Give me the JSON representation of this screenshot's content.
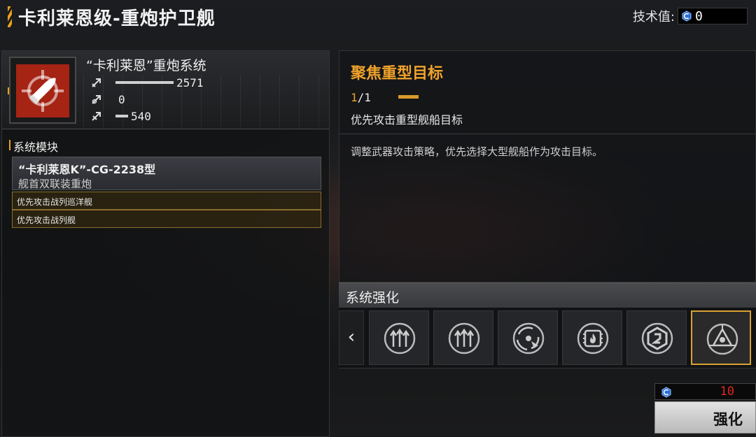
{
  "header": {
    "title": "卡利莱恩级-重炮护卫舰",
    "tech_label": "技术值:",
    "tech_value": "0"
  },
  "weapon": {
    "name": "“卡利莱恩”重炮系统",
    "stats": [
      {
        "icon": "damage-icon",
        "value": "2571",
        "bar": 0.54
      },
      {
        "icon": "range-icon",
        "value": "0",
        "bar": 0
      },
      {
        "icon": "armor-pierce-icon",
        "value": "540",
        "bar": 0.12
      }
    ]
  },
  "modules": {
    "title": "系统模块",
    "module_name": "“卡利莱恩K”-CG-2238型",
    "module_sub": "舰首双联装重炮",
    "options": [
      "优先攻击战列巡洋舰",
      "优先攻击战列舰"
    ]
  },
  "focus": {
    "title": "聚焦重型目标",
    "level_current": "1",
    "level_total": "/1",
    "level_fill": 1.0,
    "desc": "优先攻击重型舰船目标",
    "long_desc": "调整武器攻击策略，优先选择大型舰船作为攻击目标。"
  },
  "enhance": {
    "title": "系统强化",
    "prev_arrow": "‹",
    "slots": [
      {
        "icon": "triple-arrow-up-icon",
        "selected": false
      },
      {
        "icon": "triple-arrow-up-icon",
        "selected": false
      },
      {
        "icon": "radar-sweep-icon",
        "selected": false
      },
      {
        "icon": "fire-chip-icon",
        "selected": false
      },
      {
        "icon": "hex-shield-icon",
        "selected": false
      },
      {
        "icon": "target-focus-icon",
        "selected": true
      }
    ],
    "cost": "10",
    "button": "强化"
  },
  "colors": {
    "accent": "#f1a32a",
    "weapon_icon_bg": "#a52414",
    "cost_red": "#e0261c"
  }
}
